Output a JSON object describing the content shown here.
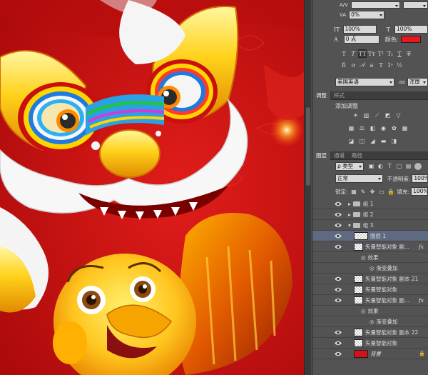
{
  "character": {
    "percent_top": "0%",
    "tracking_scale_v": "100%",
    "tracking_scale_h": "100%",
    "baseline_shift": "0 点",
    "color_label": "颜色:",
    "color_value": "#e8191e",
    "language": "美国英语",
    "aa_icon": "aa",
    "aa_mode": "浑厚"
  },
  "adjust_panel": {
    "tabs": [
      "调整",
      "样式"
    ],
    "title": "添加调整"
  },
  "layers_panel": {
    "tabs": [
      "图层",
      "通道",
      "路径"
    ],
    "filter_kind": "类型",
    "blend_mode": "正常",
    "opacity_label": "不透明度:",
    "opacity_value": "100%",
    "lock_label": "锁定:",
    "fill_label": "填充:",
    "fill_value": "100%",
    "layers": [
      {
        "name": "组 1",
        "type": "group"
      },
      {
        "name": "组 2",
        "type": "group"
      },
      {
        "name": "组 3",
        "type": "group-open"
      },
      {
        "name": "图层 1",
        "type": "layer",
        "selected": true
      },
      {
        "name": "矢量智能对象 副...",
        "type": "smart",
        "fx": "fx"
      },
      {
        "name": "效果",
        "type": "effect"
      },
      {
        "name": "渐变叠加",
        "type": "effect-item"
      },
      {
        "name": "矢量智能对象 副本 21",
        "type": "smart"
      },
      {
        "name": "矢量智能对象",
        "type": "smart"
      },
      {
        "name": "矢量智能对象 副...",
        "type": "smart",
        "fx": "fx"
      },
      {
        "name": "效果",
        "type": "effect"
      },
      {
        "name": "渐变叠加",
        "type": "effect-item"
      },
      {
        "name": "矢量智能对象 副本 22",
        "type": "smart"
      },
      {
        "name": "矢量智能对象",
        "type": "smart"
      },
      {
        "name": "背景",
        "type": "background"
      }
    ]
  },
  "colors": {
    "canvas_red": "#c8100f",
    "panel": "#535353",
    "selection": "#5d6a82"
  }
}
